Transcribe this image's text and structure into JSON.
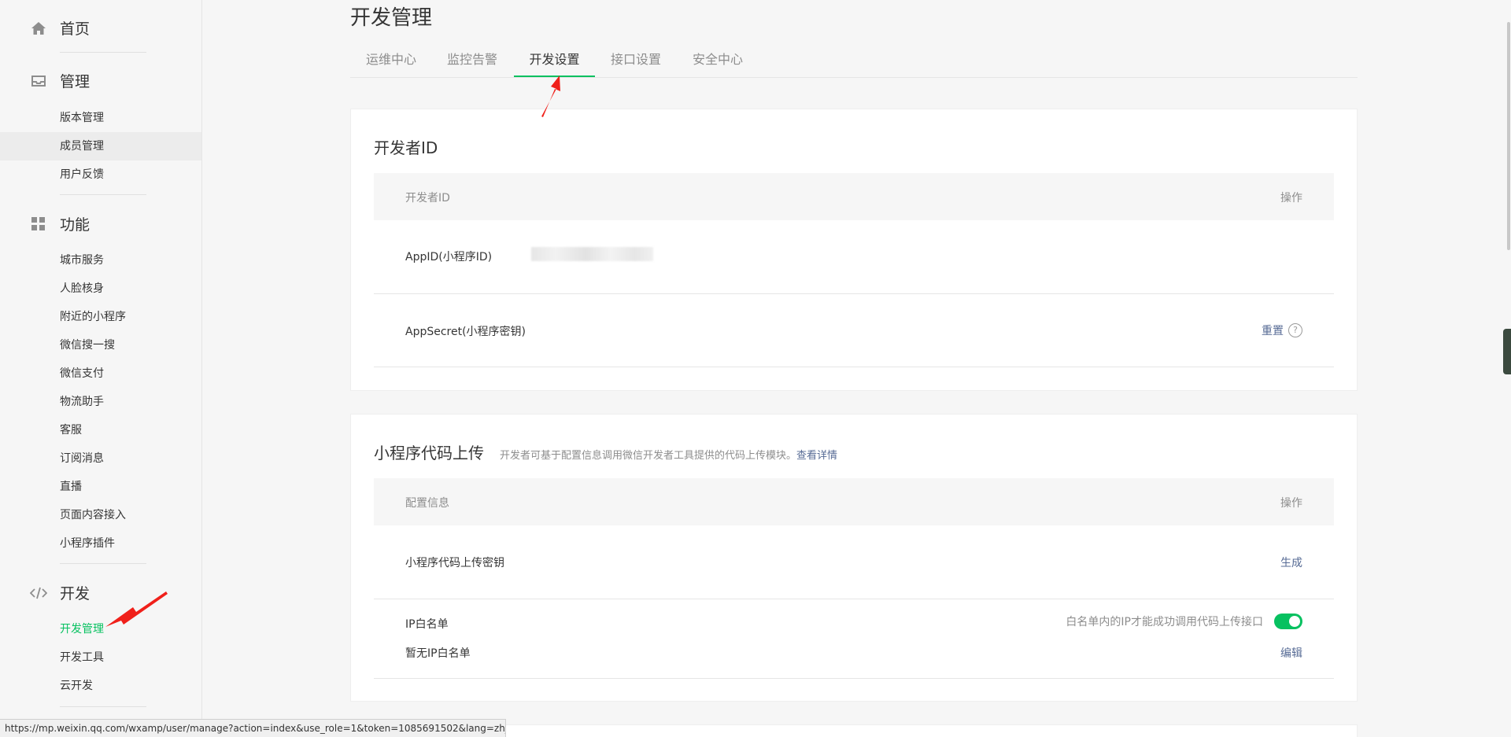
{
  "sidebar": {
    "home": {
      "label": "首页",
      "icon": "home-icon"
    },
    "manage": {
      "label": "管理",
      "icon": "inbox-icon",
      "items": [
        "版本管理",
        "成员管理",
        "用户反馈"
      ]
    },
    "features": {
      "label": "功能",
      "icon": "grid-icon",
      "items": [
        "城市服务",
        "人脸核身",
        "附近的小程序",
        "微信搜一搜",
        "微信支付",
        "物流助手",
        "客服",
        "订阅消息",
        "直播",
        "页面内容接入",
        "小程序插件"
      ]
    },
    "develop": {
      "label": "开发",
      "icon": "code-icon",
      "items": [
        "开发管理",
        "开发工具",
        "云开发"
      ]
    }
  },
  "header": {
    "title": "开发管理"
  },
  "tabs": [
    "运维中心",
    "监控告警",
    "开发设置",
    "接口设置",
    "安全中心"
  ],
  "developer_id": {
    "title": "开发者ID",
    "col_left": "开发者ID",
    "col_right": "操作",
    "appid_label": "AppID(小程序ID)",
    "secret_label": "AppSecret(小程序密钥)",
    "reset_label": "重置",
    "help_glyph": "?"
  },
  "code_upload": {
    "title": "小程序代码上传",
    "desc": "开发者可基于配置信息调用微信开发者工具提供的代码上传模块。",
    "detail_link": "查看详情",
    "col_left": "配置信息",
    "col_right": "操作",
    "key_label": "小程序代码上传密钥",
    "generate_label": "生成",
    "whitelist_label": "IP白名单",
    "whitelist_hint": "白名单内的IP才能成功调用代码上传接口",
    "whitelist_empty": "暂无IP白名单",
    "edit_label": "编辑",
    "whitelist_enabled": true
  },
  "status_url": "https://mp.weixin.qq.com/wxamp/user/manage?action=index&use_role=1&token=1085691502&lang=zh_...",
  "colors": {
    "accent": "#07c160",
    "link": "#576b95",
    "annotation": "#f0201a"
  }
}
